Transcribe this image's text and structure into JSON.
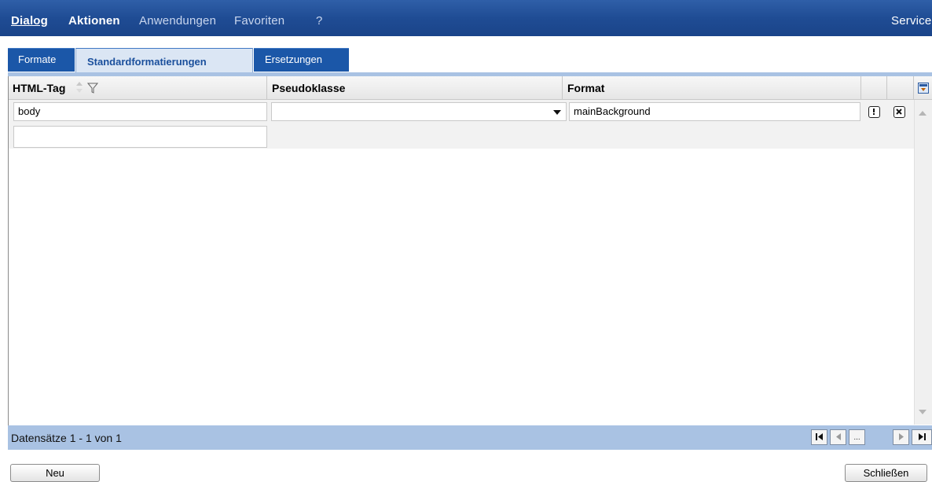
{
  "menubar": {
    "dialog": "Dialog",
    "aktionen": "Aktionen",
    "anwendungen": "Anwendungen",
    "favoriten": "Favoriten",
    "help": "?",
    "service": "Service"
  },
  "tabs": [
    {
      "label": "Formate",
      "active": false
    },
    {
      "label": "Standardformatierungen",
      "active": true
    },
    {
      "label": "Ersetzungen",
      "active": false
    }
  ],
  "table": {
    "columns": [
      "HTML-Tag",
      "Pseudoklasse",
      "Format"
    ],
    "rows": [
      {
        "html_tag": "body",
        "pseudoklasse": "",
        "format": "mainBackground"
      }
    ],
    "new_row": {
      "html_tag": ""
    }
  },
  "footer": {
    "record_info": "Datensätze 1 - 1 von 1",
    "page_more": "..."
  },
  "buttons": {
    "new": "Neu",
    "close": "Schließen"
  },
  "colors": {
    "menubar": "#1f4c94",
    "tab": "#1b57a8",
    "tab_active_bg": "#dbe6f4",
    "accent_band": "#a9c2e3"
  }
}
